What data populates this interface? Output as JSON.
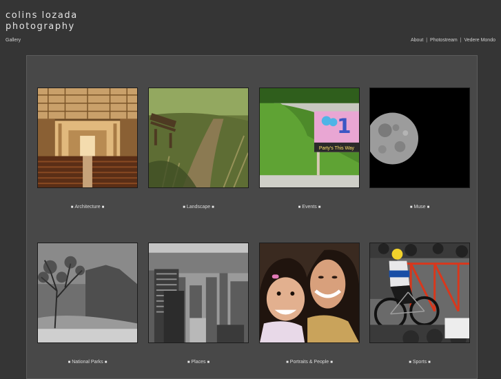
{
  "header": {
    "title_line1": "colins lozada",
    "title_line2": "photography"
  },
  "subnav": {
    "gallery_label": "Gallery"
  },
  "top_nav": {
    "items": [
      {
        "label": "About"
      },
      {
        "label": "Photostream"
      },
      {
        "label": "Vedere Mondo"
      }
    ],
    "separator": "|"
  },
  "gallery": {
    "bullet": "■",
    "items": [
      {
        "label": "Architecture"
      },
      {
        "label": "Landscape"
      },
      {
        "label": "Events",
        "sign_number": "1",
        "sign_text": "Party's This Way"
      },
      {
        "label": "Muse"
      },
      {
        "label": "National Parks"
      },
      {
        "label": "Places"
      },
      {
        "label": "Portraits & People"
      },
      {
        "label": "Sports"
      }
    ]
  }
}
